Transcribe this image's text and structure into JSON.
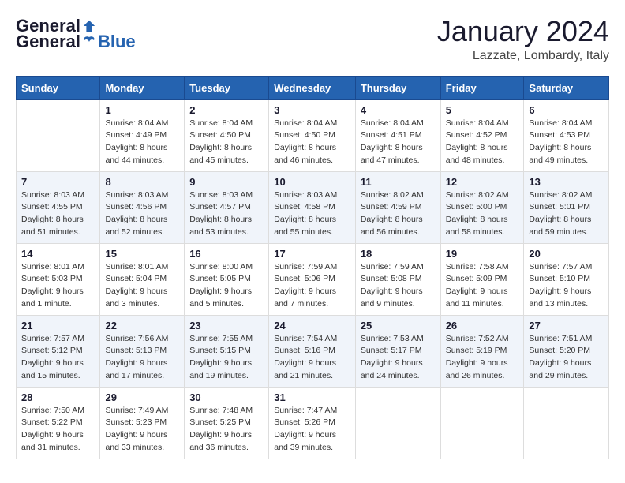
{
  "header": {
    "logo_general": "General",
    "logo_blue": "Blue",
    "month_title": "January 2024",
    "location": "Lazzate, Lombardy, Italy"
  },
  "days_of_week": [
    "Sunday",
    "Monday",
    "Tuesday",
    "Wednesday",
    "Thursday",
    "Friday",
    "Saturday"
  ],
  "weeks": [
    {
      "days": [
        {
          "num": "",
          "info": ""
        },
        {
          "num": "1",
          "info": "Sunrise: 8:04 AM\nSunset: 4:49 PM\nDaylight: 8 hours\nand 44 minutes."
        },
        {
          "num": "2",
          "info": "Sunrise: 8:04 AM\nSunset: 4:50 PM\nDaylight: 8 hours\nand 45 minutes."
        },
        {
          "num": "3",
          "info": "Sunrise: 8:04 AM\nSunset: 4:50 PM\nDaylight: 8 hours\nand 46 minutes."
        },
        {
          "num": "4",
          "info": "Sunrise: 8:04 AM\nSunset: 4:51 PM\nDaylight: 8 hours\nand 47 minutes."
        },
        {
          "num": "5",
          "info": "Sunrise: 8:04 AM\nSunset: 4:52 PM\nDaylight: 8 hours\nand 48 minutes."
        },
        {
          "num": "6",
          "info": "Sunrise: 8:04 AM\nSunset: 4:53 PM\nDaylight: 8 hours\nand 49 minutes."
        }
      ]
    },
    {
      "days": [
        {
          "num": "7",
          "info": "Sunrise: 8:03 AM\nSunset: 4:55 PM\nDaylight: 8 hours\nand 51 minutes."
        },
        {
          "num": "8",
          "info": "Sunrise: 8:03 AM\nSunset: 4:56 PM\nDaylight: 8 hours\nand 52 minutes."
        },
        {
          "num": "9",
          "info": "Sunrise: 8:03 AM\nSunset: 4:57 PM\nDaylight: 8 hours\nand 53 minutes."
        },
        {
          "num": "10",
          "info": "Sunrise: 8:03 AM\nSunset: 4:58 PM\nDaylight: 8 hours\nand 55 minutes."
        },
        {
          "num": "11",
          "info": "Sunrise: 8:02 AM\nSunset: 4:59 PM\nDaylight: 8 hours\nand 56 minutes."
        },
        {
          "num": "12",
          "info": "Sunrise: 8:02 AM\nSunset: 5:00 PM\nDaylight: 8 hours\nand 58 minutes."
        },
        {
          "num": "13",
          "info": "Sunrise: 8:02 AM\nSunset: 5:01 PM\nDaylight: 8 hours\nand 59 minutes."
        }
      ]
    },
    {
      "days": [
        {
          "num": "14",
          "info": "Sunrise: 8:01 AM\nSunset: 5:03 PM\nDaylight: 9 hours\nand 1 minute."
        },
        {
          "num": "15",
          "info": "Sunrise: 8:01 AM\nSunset: 5:04 PM\nDaylight: 9 hours\nand 3 minutes."
        },
        {
          "num": "16",
          "info": "Sunrise: 8:00 AM\nSunset: 5:05 PM\nDaylight: 9 hours\nand 5 minutes."
        },
        {
          "num": "17",
          "info": "Sunrise: 7:59 AM\nSunset: 5:06 PM\nDaylight: 9 hours\nand 7 minutes."
        },
        {
          "num": "18",
          "info": "Sunrise: 7:59 AM\nSunset: 5:08 PM\nDaylight: 9 hours\nand 9 minutes."
        },
        {
          "num": "19",
          "info": "Sunrise: 7:58 AM\nSunset: 5:09 PM\nDaylight: 9 hours\nand 11 minutes."
        },
        {
          "num": "20",
          "info": "Sunrise: 7:57 AM\nSunset: 5:10 PM\nDaylight: 9 hours\nand 13 minutes."
        }
      ]
    },
    {
      "days": [
        {
          "num": "21",
          "info": "Sunrise: 7:57 AM\nSunset: 5:12 PM\nDaylight: 9 hours\nand 15 minutes."
        },
        {
          "num": "22",
          "info": "Sunrise: 7:56 AM\nSunset: 5:13 PM\nDaylight: 9 hours\nand 17 minutes."
        },
        {
          "num": "23",
          "info": "Sunrise: 7:55 AM\nSunset: 5:15 PM\nDaylight: 9 hours\nand 19 minutes."
        },
        {
          "num": "24",
          "info": "Sunrise: 7:54 AM\nSunset: 5:16 PM\nDaylight: 9 hours\nand 21 minutes."
        },
        {
          "num": "25",
          "info": "Sunrise: 7:53 AM\nSunset: 5:17 PM\nDaylight: 9 hours\nand 24 minutes."
        },
        {
          "num": "26",
          "info": "Sunrise: 7:52 AM\nSunset: 5:19 PM\nDaylight: 9 hours\nand 26 minutes."
        },
        {
          "num": "27",
          "info": "Sunrise: 7:51 AM\nSunset: 5:20 PM\nDaylight: 9 hours\nand 29 minutes."
        }
      ]
    },
    {
      "days": [
        {
          "num": "28",
          "info": "Sunrise: 7:50 AM\nSunset: 5:22 PM\nDaylight: 9 hours\nand 31 minutes."
        },
        {
          "num": "29",
          "info": "Sunrise: 7:49 AM\nSunset: 5:23 PM\nDaylight: 9 hours\nand 33 minutes."
        },
        {
          "num": "30",
          "info": "Sunrise: 7:48 AM\nSunset: 5:25 PM\nDaylight: 9 hours\nand 36 minutes."
        },
        {
          "num": "31",
          "info": "Sunrise: 7:47 AM\nSunset: 5:26 PM\nDaylight: 9 hours\nand 39 minutes."
        },
        {
          "num": "",
          "info": ""
        },
        {
          "num": "",
          "info": ""
        },
        {
          "num": "",
          "info": ""
        }
      ]
    }
  ]
}
